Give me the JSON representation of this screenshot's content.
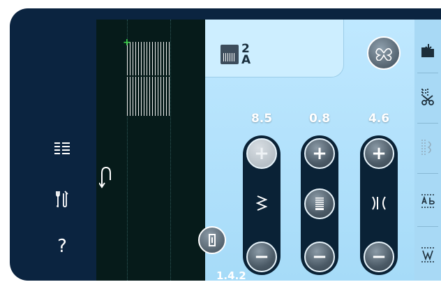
{
  "settings": {
    "stitch_id_top": "2",
    "stitch_id_bottom": "A",
    "columns": [
      {
        "name": "stitch-width",
        "value": "8.5"
      },
      {
        "name": "stitch-length",
        "value": "0.8"
      },
      {
        "name": "stitch-positioning",
        "value": "4.6"
      }
    ]
  },
  "status": {
    "text": "1.4.2"
  },
  "icons": {
    "left": [
      "menu-list-icon",
      "tools-icon",
      "help-icon"
    ],
    "right": [
      "file-open-icon",
      "thread-cutter-icon",
      "sequence-icon",
      "text-editor-icon",
      "stitch-program-icon"
    ]
  },
  "help": {
    "label": "?"
  },
  "colors": {
    "frame": "#0b2440",
    "panel": "#a6dbf8",
    "preview": "#061b1a",
    "start_marker": "#3cd04a"
  }
}
